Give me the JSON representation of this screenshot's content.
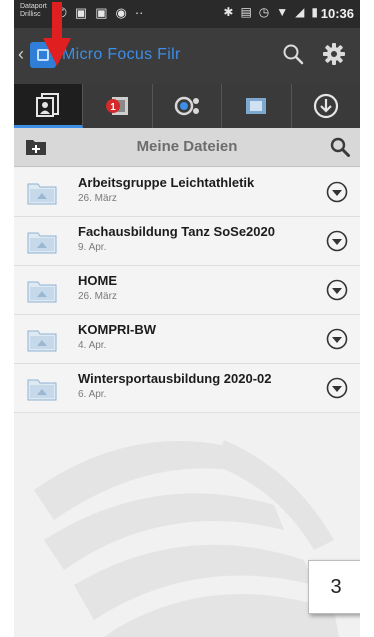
{
  "statusbar": {
    "carrier_line1": "Dataport",
    "carrier_line2": "Drillisc",
    "time": "10:36"
  },
  "appbar": {
    "title": "Micro Focus Filr",
    "back_icon": "chevron-left-icon",
    "search_icon": "search-icon",
    "settings_icon": "gear-icon"
  },
  "tabs": [
    {
      "icon": "my-files-icon",
      "active": true
    },
    {
      "icon": "shared-with-me-icon",
      "badge": "1"
    },
    {
      "icon": "shared-by-me-icon"
    },
    {
      "icon": "net-folders-icon"
    },
    {
      "icon": "downloads-icon"
    }
  ],
  "section": {
    "title": "Meine Dateien"
  },
  "files": [
    {
      "name": "Arbeitsgruppe Leichtathletik",
      "date": "26. März"
    },
    {
      "name": "Fachausbildung Tanz SoSe2020",
      "date": "9. Apr."
    },
    {
      "name": "HOME",
      "date": "26. März"
    },
    {
      "name": "KOMPRI-BW",
      "date": "4. Apr."
    },
    {
      "name": "Wintersportausbildung 2020-02",
      "date": "6. Apr."
    }
  ],
  "page_badge": "3",
  "colors": {
    "accent": "#3d8ee6",
    "annotation_red": "#e02020",
    "badge_red": "#d42a2a"
  }
}
